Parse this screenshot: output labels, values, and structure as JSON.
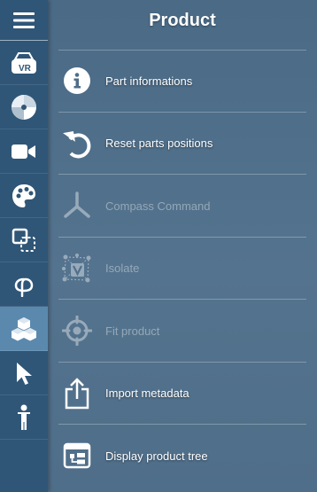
{
  "panel": {
    "title": "Product"
  },
  "rail": {
    "items": [
      {
        "icon": "hamburger-menu-icon"
      },
      {
        "icon": "vr-headset-icon",
        "badge": "VR"
      },
      {
        "icon": "disc-icon"
      },
      {
        "icon": "video-camera-icon"
      },
      {
        "icon": "palette-icon"
      },
      {
        "icon": "section-box-icon"
      },
      {
        "icon": "phi-icon"
      },
      {
        "icon": "cubes-icon",
        "active": true
      },
      {
        "icon": "cursor-arrow-icon"
      },
      {
        "icon": "person-icon"
      }
    ]
  },
  "menu": {
    "items": [
      {
        "label": "Part informations",
        "icon": "info-icon",
        "enabled": true
      },
      {
        "label": "Reset parts positions",
        "icon": "reset-arrow-icon",
        "enabled": true
      },
      {
        "label": "Compass Command",
        "icon": "compass-icon",
        "enabled": false
      },
      {
        "label": "Isolate",
        "icon": "isolate-icon",
        "enabled": false
      },
      {
        "label": "Fit product",
        "icon": "crosshair-icon",
        "enabled": false
      },
      {
        "label": "Import metadata",
        "icon": "share-upload-icon",
        "enabled": true
      },
      {
        "label": "Display product tree",
        "icon": "tree-window-icon",
        "enabled": true
      }
    ]
  },
  "colors": {
    "rail_bg": "#2f5677",
    "rail_active": "#5b89ae",
    "panel_bg": "#4f6d88",
    "text": "#ffffff",
    "disabled_text": "rgba(255,255,255,0.38)"
  }
}
